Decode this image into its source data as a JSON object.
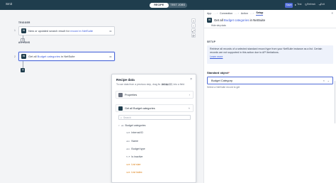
{
  "app": {
    "title": "Smit",
    "mode_tabs": [
      "RECIPE",
      "TEST JOBS"
    ],
    "active_mode": "RECIPE",
    "save_label": "Save",
    "test_label": "Test",
    "refresh_label": "Refresh",
    "exit_label": "Exit"
  },
  "canvas": {
    "trigger_label": "TRIGGER",
    "actions_label": "ACTIONS",
    "trigger": {
      "number": "1",
      "text_before": "New or updated search result for ",
      "text_highlight": "record in NetSuite"
    },
    "action": {
      "number": "2",
      "text_before": "Get all ",
      "text_highlight": "Budget categories",
      "text_after": " in NetSuite"
    },
    "zoom_buttons": [
      "+",
      "−",
      "⤢",
      "⟳"
    ]
  },
  "recipe_data": {
    "title": "Recipe data",
    "subtitle_before": "To use data from a previous step, drag its ",
    "subtitle_code": "datapill",
    "subtitle_after": " into a field",
    "sections": [
      {
        "label": "Properties",
        "icon": "grid-icon"
      },
      {
        "label_before": "Get all ",
        "label_highlight": "Budget categories",
        "icon": "netsuite-icon"
      }
    ],
    "search_placeholder": "Search",
    "tree": [
      {
        "type": "ab",
        "label": "Budget categories",
        "indent": 0,
        "expanded": true
      },
      {
        "type": "123",
        "label": "Internal ID",
        "indent": 1
      },
      {
        "type": "abc",
        "label": "Name",
        "indent": 1
      },
      {
        "type": "abc",
        "label": "Budget type",
        "indent": 1
      },
      {
        "type": "T/F",
        "label": "Is inactive",
        "indent": 1
      },
      {
        "type": "123",
        "label": "List size",
        "indent": 1,
        "accent": true
      },
      {
        "type": "123",
        "label": "List index",
        "indent": 1,
        "accent": true
      }
    ]
  },
  "panel": {
    "breadcrumbs": [
      "App",
      "Connection",
      "Action",
      "Setup"
    ],
    "active_crumb": "Setup",
    "header_before": "Get all ",
    "header_highlight": "Budget categories",
    "header_after": " in NetSuite",
    "hide_step": "Hide step data",
    "setup_label": "SETUP",
    "info_text": "Retrieve all records of a selected standard record type from your NetSuite instance as a list. Certain records are not supported in this action due to API limitations.",
    "learn_more": "Learn more",
    "field_label": "Standard object",
    "field_required": "*",
    "field_value": "Budget Category",
    "field_hint": "Select a NetSuite record to get"
  }
}
